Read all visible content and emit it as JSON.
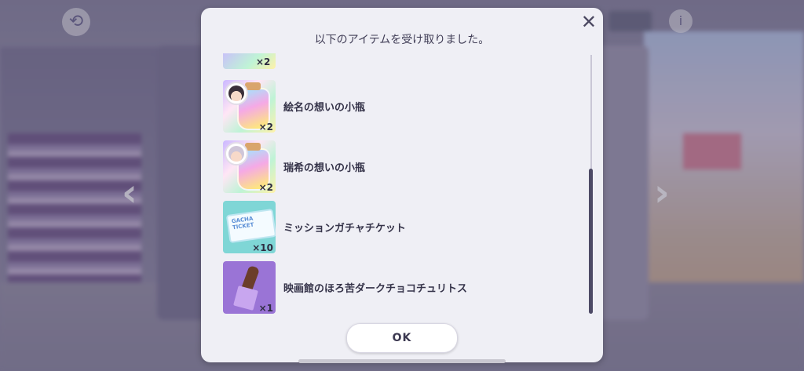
{
  "dialog": {
    "title": "以下のアイテムを受け取りました。",
    "ok_label": "OK",
    "close_icon": "✕",
    "partial_item_qty": "×2",
    "items": [
      {
        "name": "絵名の想いの小瓶",
        "qty": "×2",
        "icon": "bottle-ena-icon"
      },
      {
        "name": "瑞希の想いの小瓶",
        "qty": "×2",
        "icon": "bottle-mizuki-icon"
      },
      {
        "name": "ミッションガチャチケット",
        "qty": "×10",
        "icon": "gacha-ticket-icon",
        "ticket_text": "GACHA TICKET"
      },
      {
        "name": "映画館のほろ苦ダークチョコチュリトス",
        "qty": "×1",
        "icon": "churros-icon"
      }
    ]
  },
  "background": {
    "back_icon": "⟲",
    "info_icon": "i",
    "left_arrow": "‹",
    "right_arrow": "›"
  }
}
